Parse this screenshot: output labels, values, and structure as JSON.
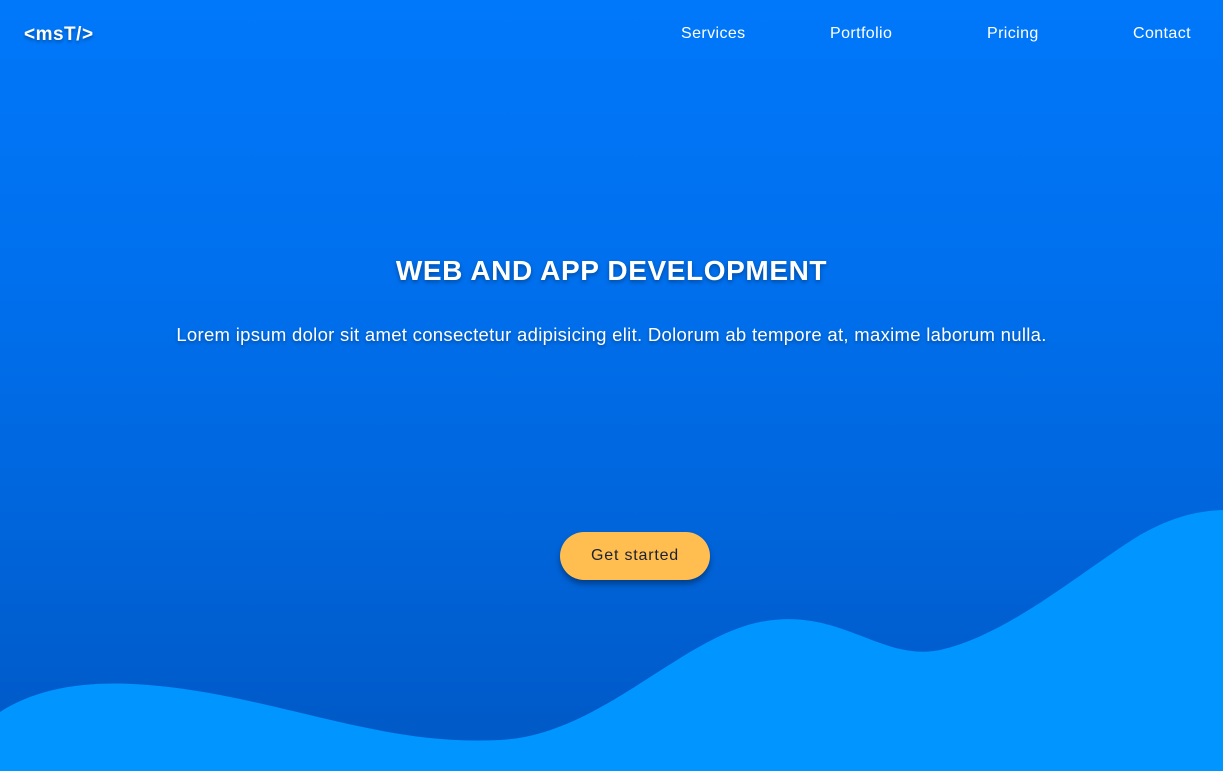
{
  "brand": {
    "logo_text": "<msT/>"
  },
  "nav": {
    "items": [
      {
        "label": "Services"
      },
      {
        "label": "Portfolio"
      },
      {
        "label": "Pricing"
      },
      {
        "label": "Contact"
      }
    ]
  },
  "hero": {
    "title": "WEB AND APP DEVELOPMENT",
    "subtitle": "Lorem ipsum dolor sit amet consectetur adipisicing elit. Dolorum ab tempore at, maxime laborum nulla.",
    "cta_label": "Get started"
  },
  "colors": {
    "background_top": "#0078fa",
    "background_bottom": "#0058c4",
    "wave": "#0095ff",
    "cta_background": "#ffbe4f",
    "text": "#ffffff"
  }
}
